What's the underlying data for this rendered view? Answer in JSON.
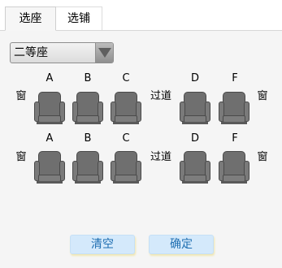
{
  "tabs": [
    {
      "label": "选座",
      "active": true
    },
    {
      "label": "选铺",
      "active": false
    }
  ],
  "seat_class_select": {
    "value": "二等座"
  },
  "seat_rows": [
    {
      "column_letters": [
        "A",
        "B",
        "C",
        "D",
        "F"
      ],
      "window_left": "窗",
      "aisle": "过道",
      "window_right": "窗"
    },
    {
      "column_letters": [
        "A",
        "B",
        "C",
        "D",
        "F"
      ],
      "window_left": "窗",
      "aisle": "过道",
      "window_right": "窗"
    }
  ],
  "buttons": {
    "clear": "清空",
    "confirm": "确定"
  },
  "colors": {
    "seat_fill": "#6f6f6f",
    "button_fill": "#d4e9fb",
    "button_text": "#1f6fb2",
    "panel_bg": "#f5f5f5"
  }
}
